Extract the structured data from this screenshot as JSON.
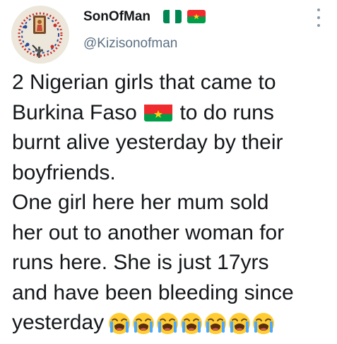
{
  "tweet": {
    "display_name": "SonOfMan",
    "handle": "@Kizisonofman",
    "name_flags": [
      "nigeria-flag-icon",
      "burkina-faso-flag-icon"
    ],
    "lines": [
      "2 Nigerian girls that came to",
      "Burkina Faso",
      "to do runs",
      "burnt alive yesterday by their",
      "boyfriends.",
      "One girl here her mum sold",
      "her out to another woman for",
      "runs here. She is just 17yrs",
      "and have been bleeding since",
      "yesterday"
    ],
    "emoji": "loudly-crying-face-icon",
    "emoji_count": 7
  },
  "colors": {
    "text": "#14171a",
    "secondary": "#5b7083",
    "nigeria_green": "#008751",
    "burkina_red": "#EF2B2D",
    "burkina_green": "#009E49",
    "burkina_star": "#FCD116"
  }
}
